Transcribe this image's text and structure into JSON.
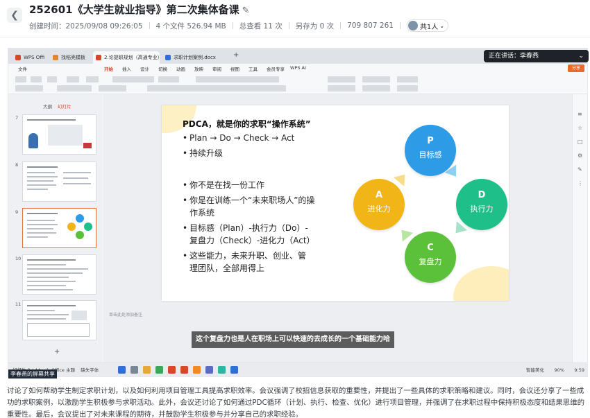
{
  "header": {
    "title": "252601《大学生就业指导》第二次集体备课",
    "created": "创建时间：2025/09/08 09:26:05",
    "files": "4 个文件 526.94 MB",
    "views": "总查看 11 次",
    "saved": "另存为 0 次",
    "meeting_id": "709 807 261",
    "share": "共1人",
    "back_icon": "back-icon",
    "edit_icon": "pencil-icon"
  },
  "speaking": {
    "label": "正在讲话：李春燕",
    "icon": "chevron-down-icon"
  },
  "sharer": "李春燕的屏幕共享",
  "wps": {
    "tabs": [
      "WPS Office",
      "找稻壳模板",
      "2.论提职规划（高通专业）",
      "求职计划案例.docx"
    ],
    "menu": [
      "文件",
      "开始",
      "插入",
      "设计",
      "切换",
      "动画",
      "放映",
      "审阅",
      "视图",
      "工具",
      "会员专享",
      "WPS AI"
    ],
    "share_btn": "分享",
    "panel_tabs": [
      "大纲",
      "幻灯片"
    ],
    "thumb_numbers": [
      "7",
      "8",
      "9",
      "10",
      "11"
    ],
    "notes_placeholder": "单击此处添加备注",
    "status_left": "幻灯片 9 / 44",
    "status_theme": "1_Office 主题",
    "status_font": "缺失字体",
    "status_right": "智能美化",
    "zoom": "90%",
    "time": "9:59"
  },
  "slide": {
    "title": "PDCA，就是你的求职“操作系统”",
    "bullets": [
      {
        "l1": "Plan → Do → Check → Act",
        "l2": ""
      },
      {
        "l1": "持续升级",
        "l2": ""
      },
      {
        "l1": "你不是在找一份工作",
        "l2": ""
      },
      {
        "l1": "你是在训练一个“未来职场人”的操",
        "l2": "作系统"
      },
      {
        "l1": "目标感（Plan）-执行力（Do）-",
        "l2": "复盘力（Check）-进化力（Act）"
      },
      {
        "l1": "这些能力，未来升职、创业、管",
        "l2": "理团队，全部用得上"
      }
    ],
    "cycle": [
      {
        "letter": "P",
        "label": "目标感"
      },
      {
        "letter": "D",
        "label": "执行力"
      },
      {
        "letter": "C",
        "label": "复盘力"
      },
      {
        "letter": "A",
        "label": "进化力"
      }
    ],
    "colors": {
      "P": "#2e9be6",
      "D": "#1fbf8a",
      "C": "#5cc13a",
      "A": "#f2b517"
    }
  },
  "caption": "这个复盘力也是人在职场上可以快速的去成长的一个基础能力哈",
  "summary": "讨论了如何帮助学生制定求职计划，以及如何利用项目管理工具提高求职效率。会议强调了校招信息获取的重要性，并提出了一些具体的求职策略和建议。同时，会议还分享了一些成功的求职案例，以激励学生积极参与求职活动。此外，会议还讨论了如何通过PDC循环（计划、执行、检查、优化）进行项目管理，并强调了在求职过程中保持积极态度和结果思维的重要性。最后，会议提出了对未来课程的期待，并鼓励学生积极参与并分享自己的求职经验。"
}
